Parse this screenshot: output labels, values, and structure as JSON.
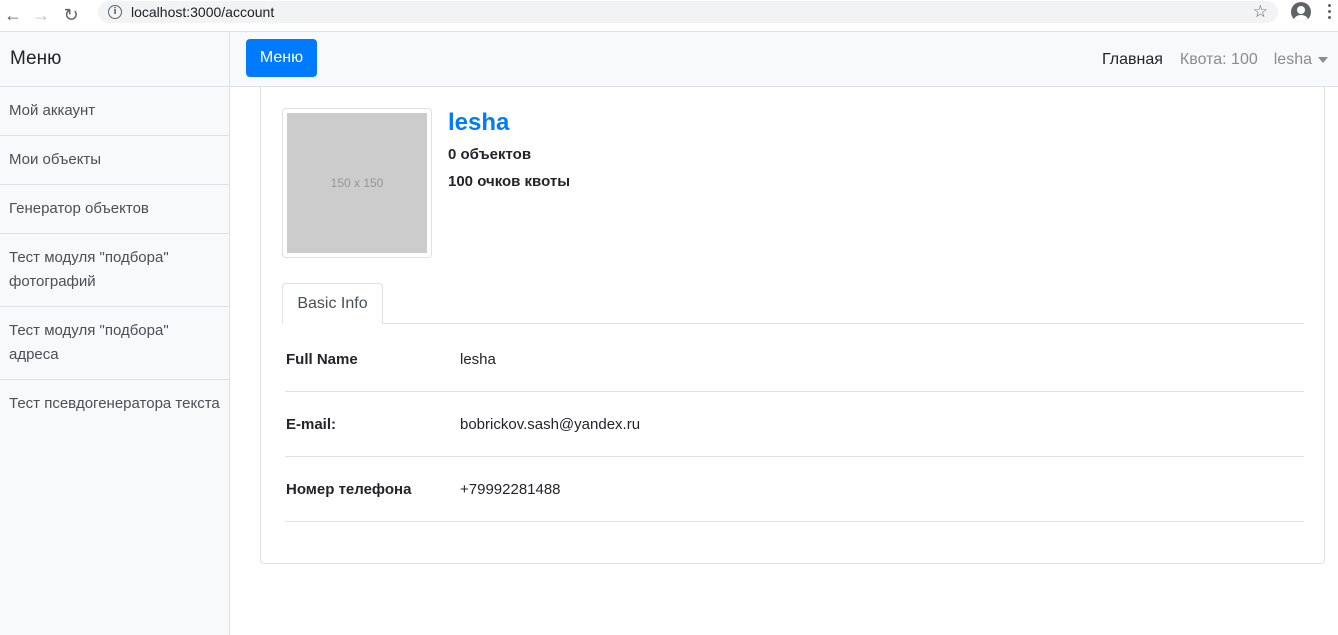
{
  "browser": {
    "url": "localhost:3000/account",
    "back_icon": "←",
    "forward_icon": "→",
    "reload_icon": "↻",
    "star_icon": "☆"
  },
  "sidebar": {
    "heading": "Меню",
    "items": [
      {
        "label": "Мой аккаунт"
      },
      {
        "label": "Мои объекты"
      },
      {
        "label": "Генератор объектов"
      },
      {
        "label": "Тест модуля \"подбора\" фотографий"
      },
      {
        "label": "Тест модуля \"подбора\" адреса"
      },
      {
        "label": "Тест псевдогенератора текста"
      }
    ]
  },
  "navbar": {
    "menu_button": "Меню",
    "home": "Главная",
    "quota": "Квота: 100",
    "user": "lesha"
  },
  "profile": {
    "avatar_placeholder": "150 x 150",
    "name": "lesha",
    "objects": "0 объектов",
    "quota": "100 очков квоты"
  },
  "tabs": [
    {
      "label": "Basic Info",
      "active": true
    }
  ],
  "info": {
    "rows": [
      {
        "label": "Full Name",
        "value": "lesha"
      },
      {
        "label": "E-mail:",
        "value": "bobrickov.sash@yandex.ru"
      },
      {
        "label": "Номер телефона",
        "value": "+79992281488"
      }
    ]
  },
  "colors": {
    "accent": "#007bff",
    "sidebar_bg": "#f8f9fa",
    "border": "#dee2e6"
  }
}
